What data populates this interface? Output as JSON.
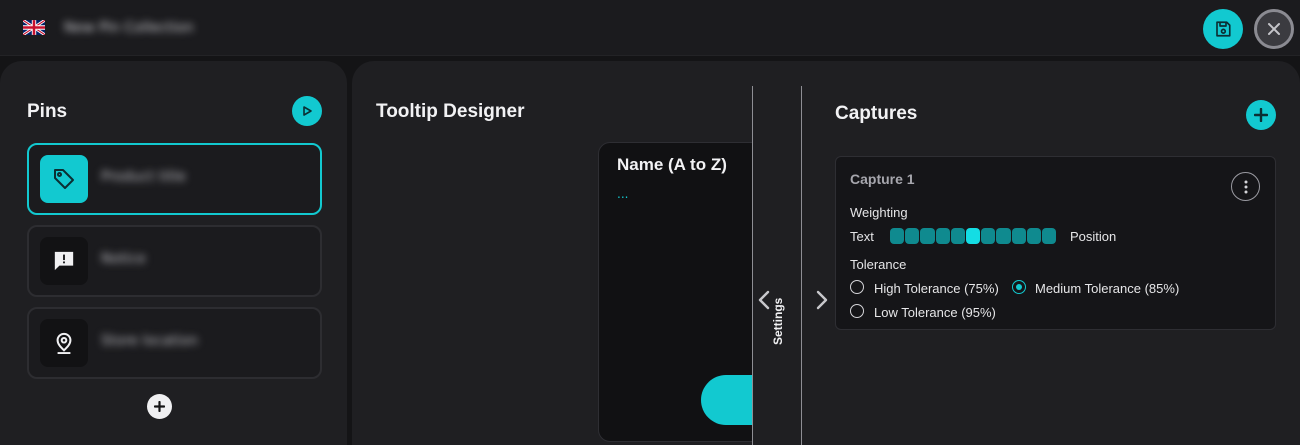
{
  "header": {
    "collection_title": "New Pin Collection",
    "flag_icon": "uk-flag-icon",
    "save_icon": "floppy-disk-icon",
    "close_icon": "close-icon",
    "accent_color": "#12c9d0"
  },
  "pins": {
    "title": "Pins",
    "play_icon": "play-icon",
    "items": [
      {
        "label": "Product title",
        "icon": "tag-icon",
        "active": true
      },
      {
        "label": "Notice",
        "icon": "alert-message-icon",
        "active": false
      },
      {
        "label": "Store location",
        "icon": "location-pin-icon",
        "active": false
      }
    ],
    "add_icon": "plus-icon"
  },
  "tooltip_designer": {
    "title": "Tooltip Designer",
    "preview": {
      "heading": "Name (A to Z)",
      "placeholder": "..."
    }
  },
  "settings": {
    "label": "Settings",
    "prev_icon": "chevron-left-icon",
    "next_icon": "chevron-right-icon"
  },
  "captures": {
    "title": "Captures",
    "add_icon": "plus-icon",
    "items": [
      {
        "name": "Capture 1",
        "menu_icon": "more-vertical-icon",
        "weighting": {
          "label": "Weighting",
          "left_label": "Text",
          "right_label": "Position",
          "segments": 11,
          "selected_index": 5
        },
        "tolerance": {
          "label": "Tolerance",
          "options": [
            {
              "label": "High Tolerance (75%)",
              "checked": false
            },
            {
              "label": "Medium Tolerance (85%)",
              "checked": true
            },
            {
              "label": "Low Tolerance (95%)",
              "checked": false
            }
          ]
        }
      }
    ]
  }
}
